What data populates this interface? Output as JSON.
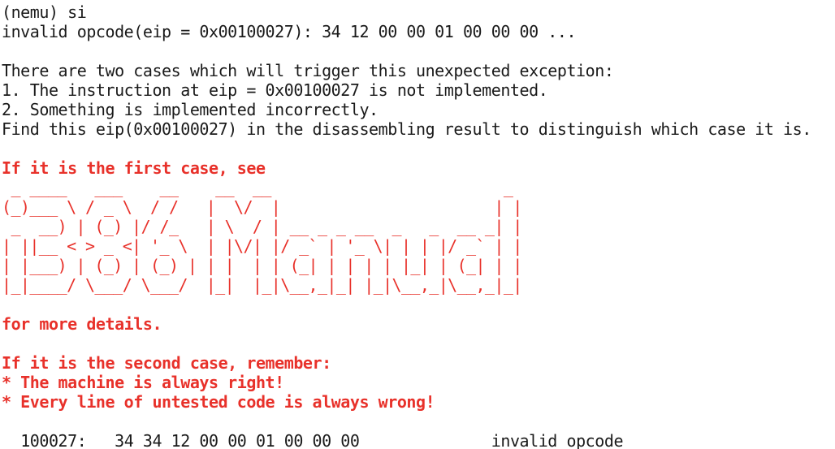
{
  "colors": {
    "text": "#1a1a1a",
    "accent_red": "#e8312a",
    "background": "#ffffff"
  },
  "session": {
    "prompt_line": "(nemu) si",
    "error_line": "invalid opcode(eip = 0x00100027): 34 12 00 00 01 00 00 00 ..."
  },
  "message": {
    "intro": "There are two cases which will trigger this unexpected exception:",
    "case1": "1. The instruction at eip = 0x00100027 is not implemented.",
    "case2": "2. Something is implemented incorrectly.",
    "find": "Find this eip(0x00100027) in the disassembling result to distinguish which case it is."
  },
  "first_case": {
    "heading": "If it is the first case, see",
    "ascii_art": [
      " _ ____   ___    __    __  __                         _ ",
      "(_)___ \\ / _ \\  / /   |  \\/  |                       | |",
      " _  __) | (_) |/ /_   | \\  / | __ _ _ __  _   _  __ _| |",
      "| ||__ < > _ <| '_ \\  | |\\/| |/ _` | '_ \\| | | |/ _` | |",
      "| |___) | (_) | (_) | | |  | | (_| | | | | |_| | (_| | |",
      "|_|____/ \\___/ \\___/  |_|  |_|\\__,_|_| |_|\\__,_|\\__,_|_|"
    ],
    "details": "for more details."
  },
  "second_case": {
    "heading": "If it is the second case, remember:",
    "rule1": "* The machine is always right!",
    "rule2": "* Every line of untested code is always wrong!"
  },
  "disassembly": {
    "address": "100027:",
    "bytes": "34 34 12 00 00 01 00 00 00",
    "instruction": "invalid opcode"
  }
}
